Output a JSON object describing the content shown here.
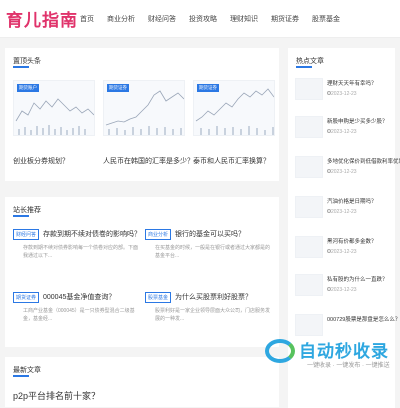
{
  "site": {
    "logo": "育儿指南"
  },
  "nav": [
    "首页",
    "商业分析",
    "财经问答",
    "投资攻略",
    "理财知识",
    "期货证券",
    "股票基金"
  ],
  "top": {
    "title": "置顶头条",
    "cards": [
      {
        "tag": "期货账户",
        "caption": "创业板分券规划？"
      },
      {
        "tag": "期货证券",
        "caption": "人民币在韩国的汇率是多少？"
      },
      {
        "tag": "期货证券",
        "caption": "泰币和人民币汇率换算？"
      }
    ]
  },
  "recommend": {
    "title": "站长推荐",
    "items": [
      {
        "badge": "财经问答",
        "title": "存款到期不续对债卷的影响吗？",
        "desc": "存款到期不续对债券影响每一个债卷对应的部。下面我通过以下..."
      },
      {
        "badge": "商业分析",
        "title": "银行的基金可以买吗？",
        "desc": "在买基金的时候，一般是在银行或者通过大家都是的基金平台..."
      },
      {
        "badge": "期货证券",
        "title": "000045基金净值查询？",
        "desc": "工商产业基金（000045）是一只债券型混合二级基金，基金经..."
      },
      {
        "badge": "股票基金",
        "title": "为什么买股票利好股票？",
        "desc": "股票利好是一家企业领导层面大众公司，门店服务发展的一种发..."
      }
    ]
  },
  "latest": {
    "title": "最新文章",
    "items": [
      "p2p平台排名前十家？"
    ]
  },
  "sidebar": {
    "title": "热点文章",
    "items": [
      {
        "title": "理财天天年有幸吗？",
        "date": "2023-12-23"
      },
      {
        "title": "新股申购是少买多少股？",
        "date": "2023-12-23"
      },
      {
        "title": "多地优化保价到低借款利率优惠？",
        "date": "2023-12-23"
      },
      {
        "title": "汽油价格是日期吗？",
        "date": "2023-12-23"
      },
      {
        "title": "黑河有价都多金数？",
        "date": "2023-12-23"
      },
      {
        "title": "私有股的为什么一直跌？",
        "date": "2023-12-23"
      },
      {
        "title": "000729股票是那盘是怎么么？",
        "date": ""
      }
    ]
  },
  "watermark": {
    "text": "自动秒收录",
    "sub": "一键收录 · 一键发布 · 一键推送"
  }
}
